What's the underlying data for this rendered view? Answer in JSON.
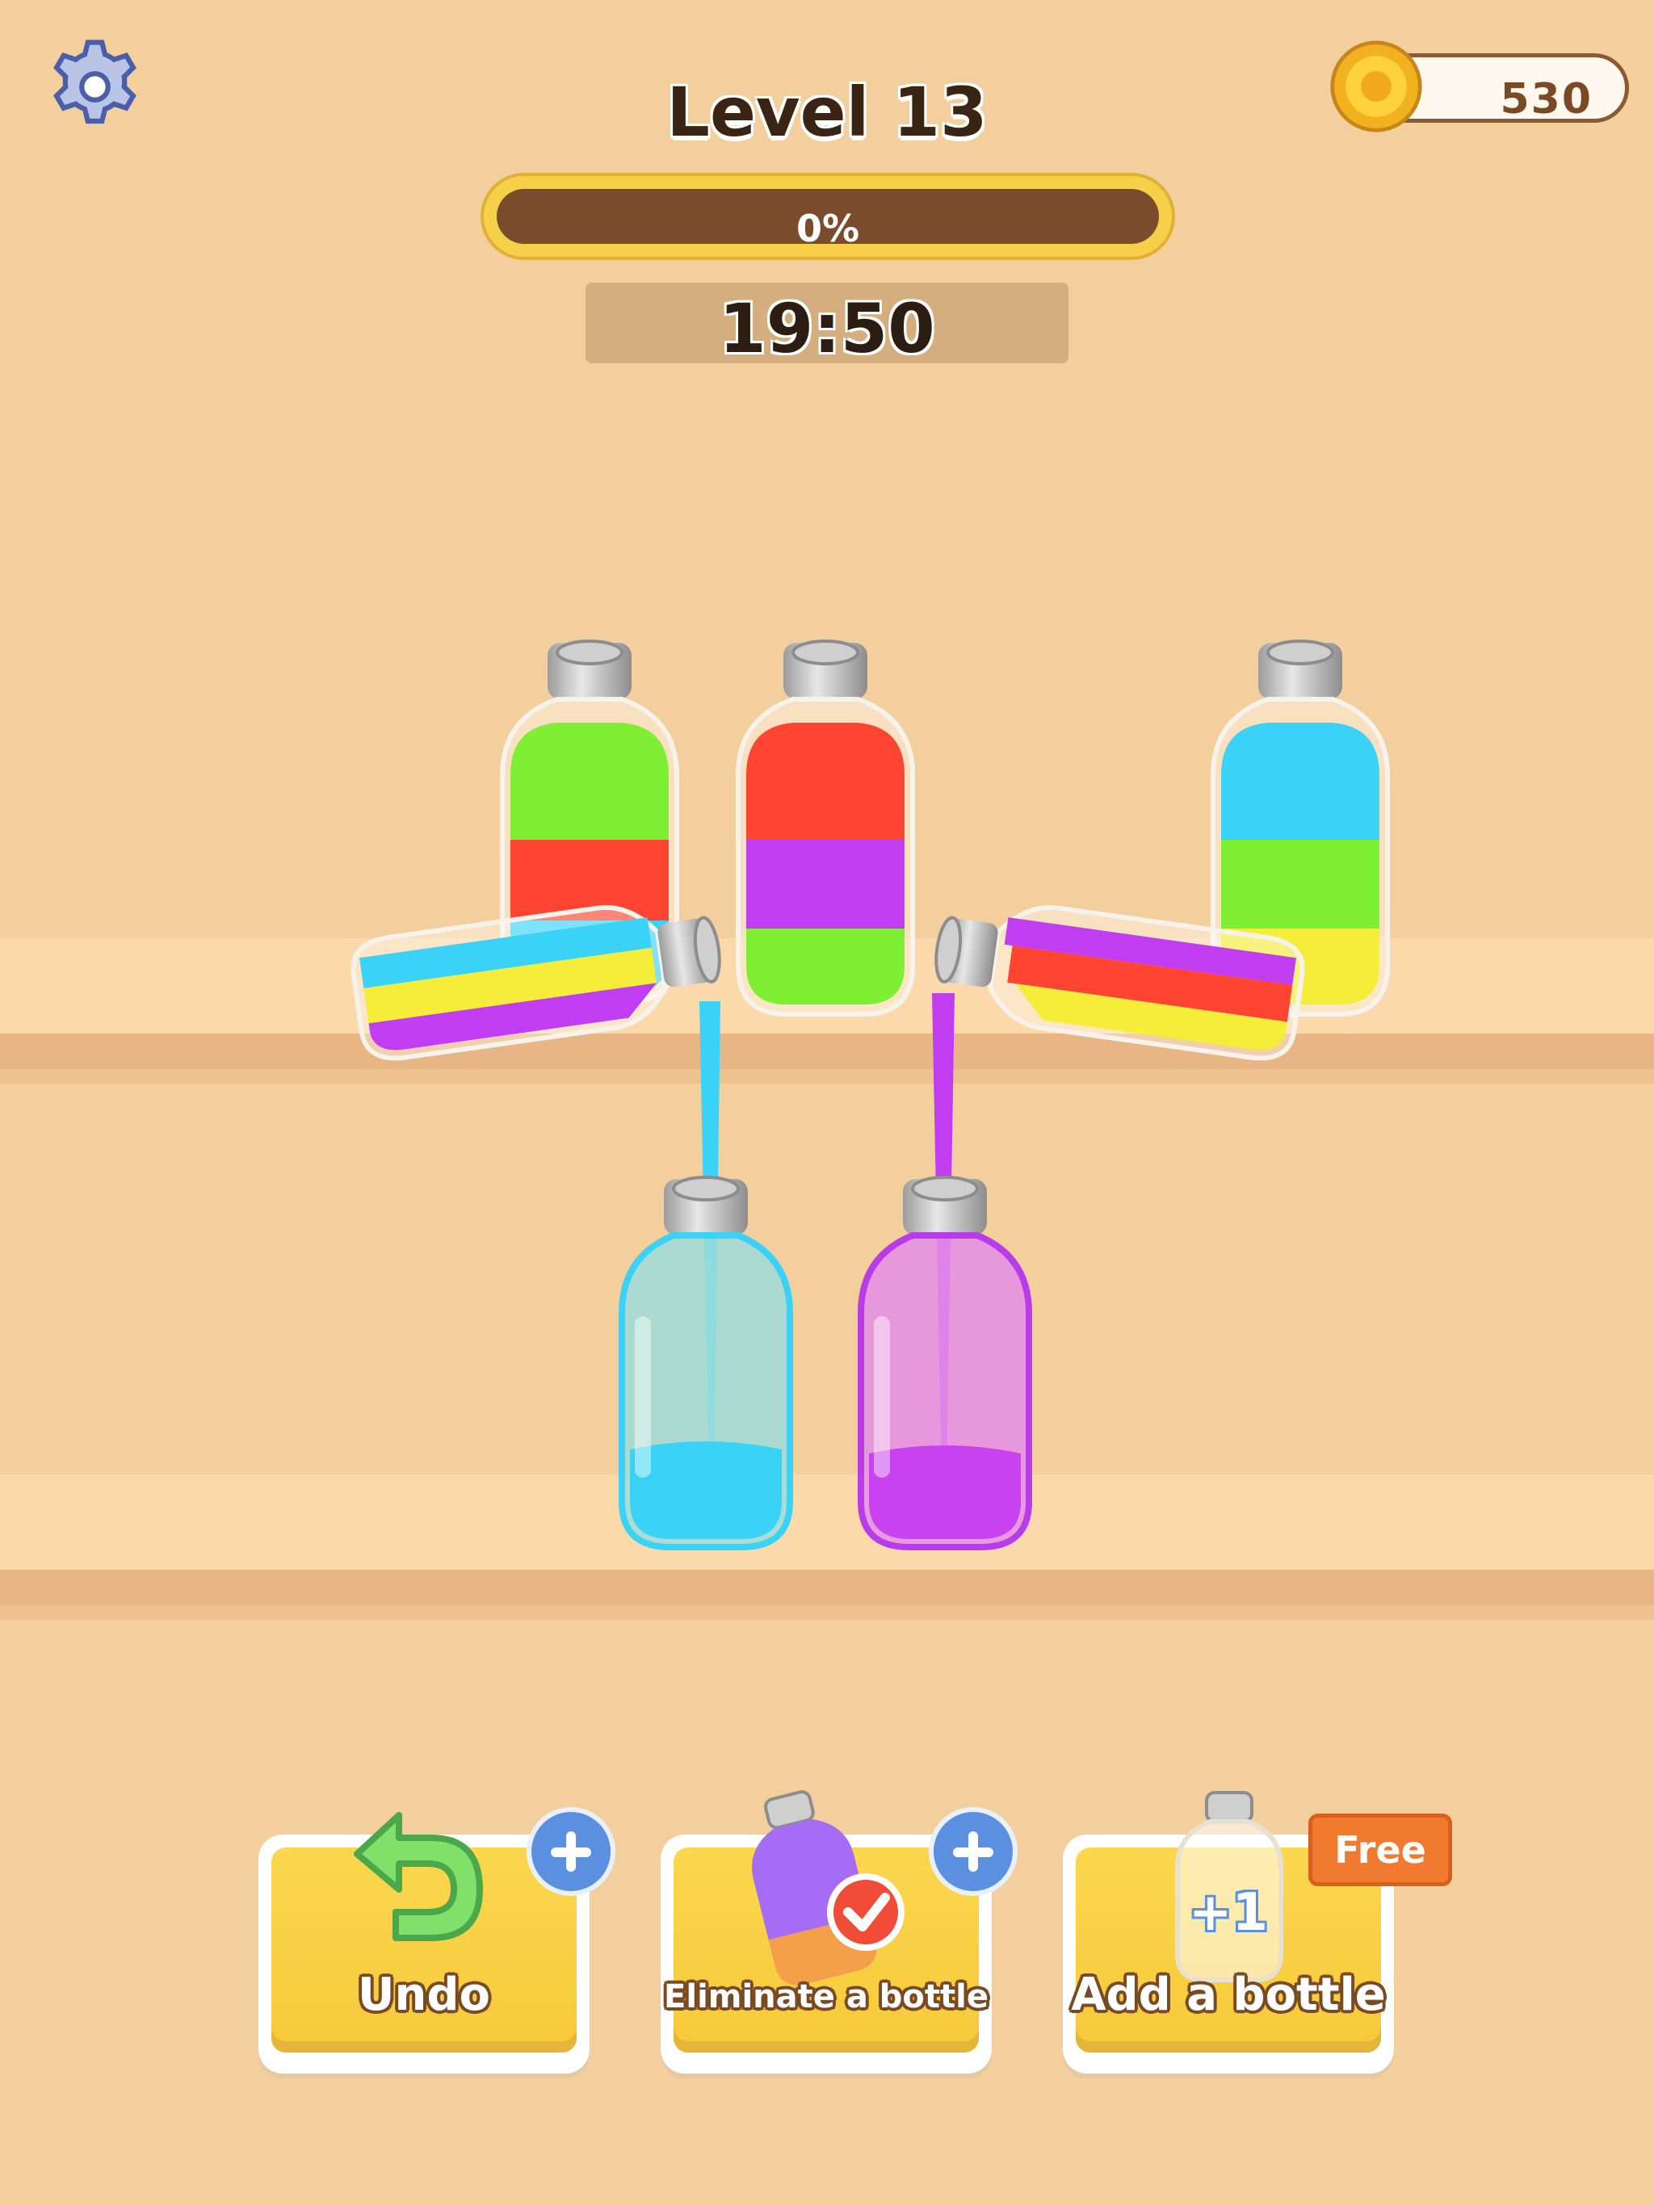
{
  "header": {
    "level_title": "Level 13",
    "progress_text": "0%",
    "progress_value": 0,
    "timer": "19:50"
  },
  "wallet": {
    "coins": "530"
  },
  "icons": {
    "settings": "gear-icon",
    "coin": "coin-icon",
    "undo": "undo-arrow-icon",
    "plus": "plus-icon",
    "check": "check-icon"
  },
  "colors": {
    "green": "#7fef34",
    "red": "#ff4432",
    "blue": "#3ad3f7",
    "purple": "#c03df1",
    "yellow": "#f5ed3a"
  },
  "bottles": [
    {
      "id": "bottle-1",
      "layers_top_to_bottom": [
        "green",
        "red",
        "blue"
      ]
    },
    {
      "id": "bottle-2",
      "layers_top_to_bottom": [
        "red",
        "purple",
        "green"
      ]
    },
    {
      "id": "bottle-3",
      "layers_top_to_bottom": [
        "blue",
        "green",
        "yellow"
      ]
    },
    {
      "id": "bottle-4-pouring",
      "layers_top_to_bottom": [
        "blue",
        "yellow",
        "purple"
      ]
    },
    {
      "id": "bottle-5-pouring",
      "layers_top_to_bottom": [
        "purple",
        "red",
        "yellow"
      ]
    },
    {
      "id": "bottle-6",
      "layers_top_to_bottom": [
        "blue"
      ]
    },
    {
      "id": "bottle-7",
      "layers_top_to_bottom": [
        "purple"
      ]
    }
  ],
  "powerups": {
    "undo_label": "Undo",
    "eliminate_label": "Eliminate a bottle",
    "add_label": "Add a bottle",
    "add_badge": "Free",
    "add_count": "+1"
  }
}
